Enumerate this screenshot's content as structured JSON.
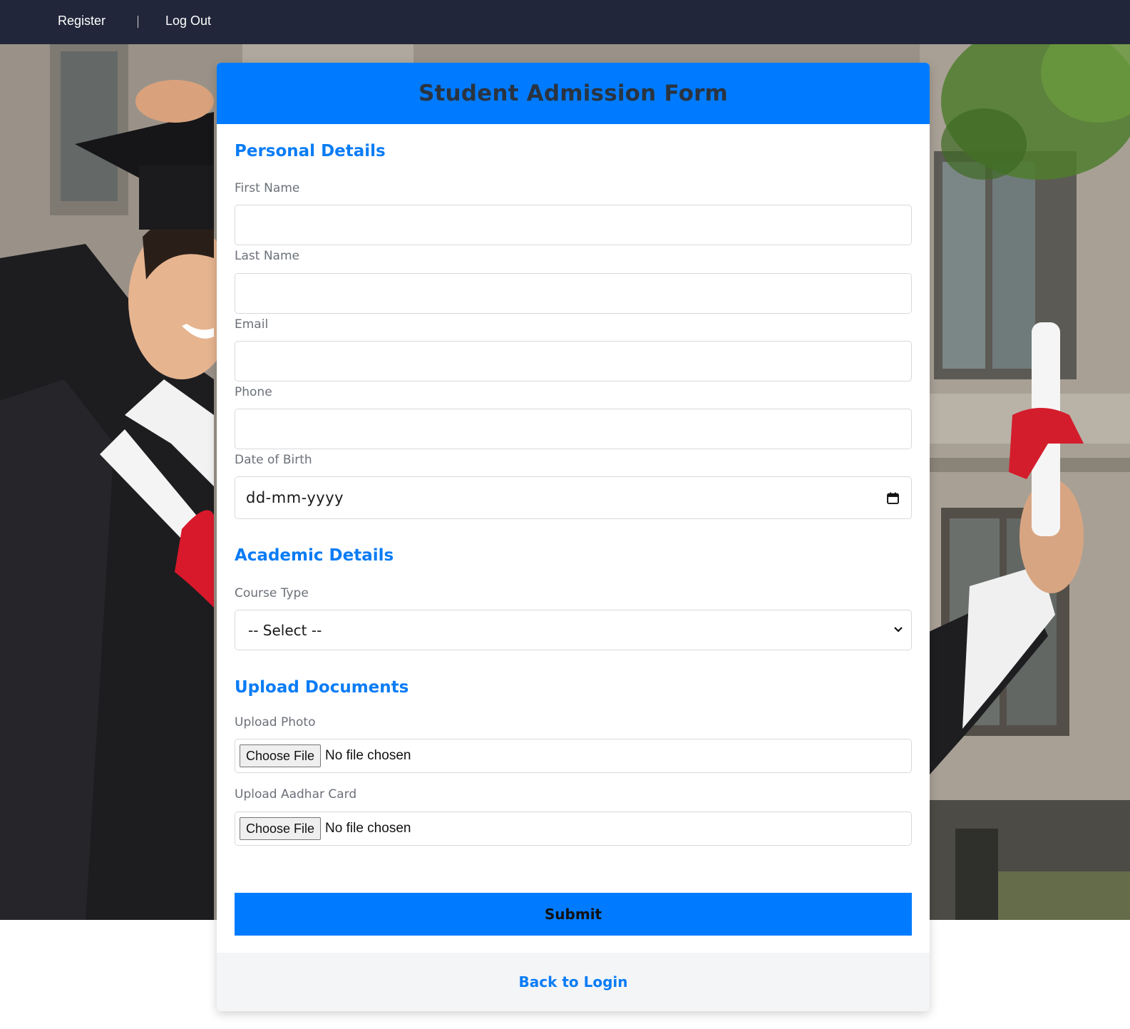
{
  "nav": {
    "register_label": "Register",
    "separator": "|",
    "logout_label": "Log Out"
  },
  "form": {
    "title": "Student Admission Form",
    "sections": {
      "personal": "Personal Details",
      "academic": "Academic Details",
      "uploads": "Upload Documents"
    },
    "fields": {
      "first_name_label": "First Name",
      "last_name_label": "Last Name",
      "email_label": "Email",
      "phone_label": "Phone",
      "dob_label": "Date of Birth",
      "dob_placeholder": "dd-mm-yyyy",
      "course_type_label": "Course Type",
      "course_type_selected": "-- Select --",
      "upload_photo_label": "Upload Photo",
      "upload_aadhar_label": "Upload Aadhar Card",
      "choose_file_label": "Choose File",
      "no_file_text": "No file chosen"
    },
    "submit_label": "Submit",
    "back_to_login_label": "Back to Login"
  },
  "colors": {
    "nav_bg": "#22263a",
    "accent": "#007bff",
    "section_title": "#0a7cf5",
    "footer_bg": "#f4f5f7"
  },
  "icons": {
    "calendar": "calendar-icon",
    "select_chevron": "chevron-down-icon"
  }
}
